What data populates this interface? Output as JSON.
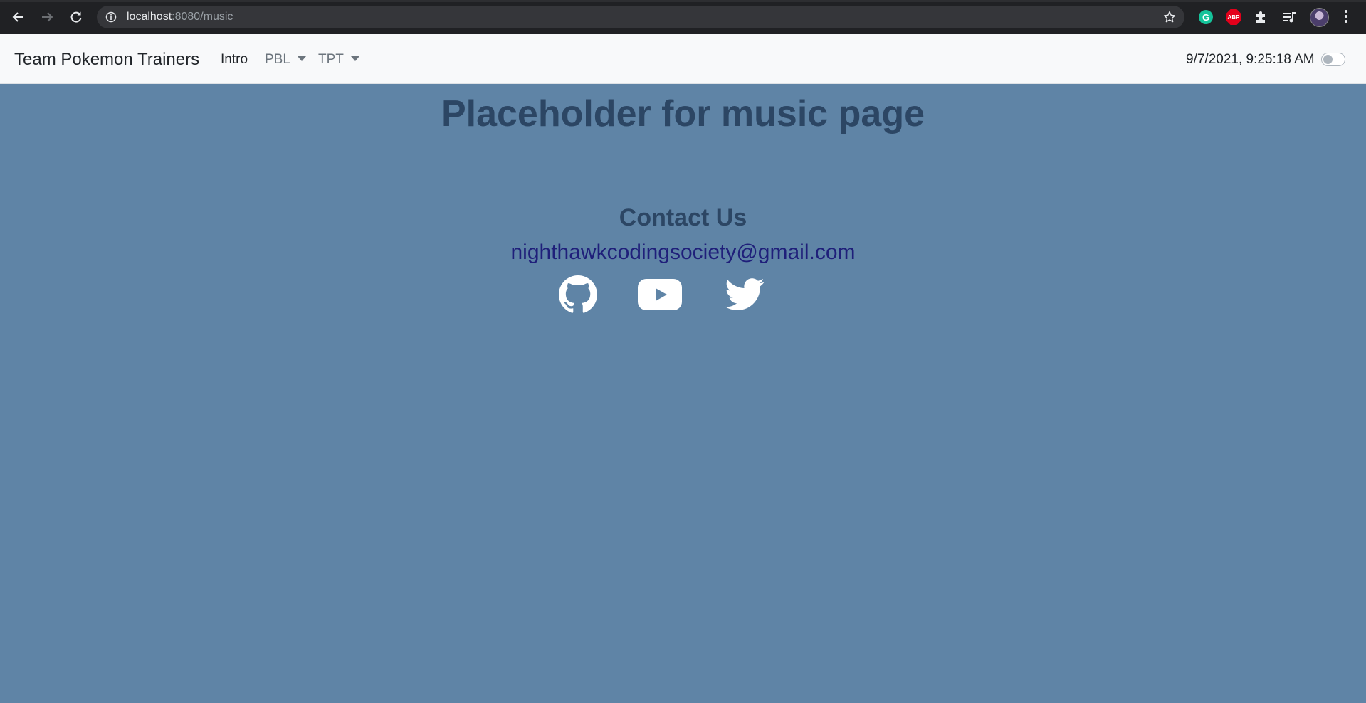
{
  "browser": {
    "url_host": "localhost",
    "url_path": ":8080/music",
    "extensions": {
      "grammarly_label": "G",
      "adblock_label": "ABP"
    }
  },
  "navbar": {
    "brand": "Team Pokemon Trainers",
    "links": [
      {
        "label": "Intro",
        "dropdown": false
      },
      {
        "label": "PBL",
        "dropdown": true
      },
      {
        "label": "TPT",
        "dropdown": true
      }
    ],
    "datetime": "9/7/2021, 9:25:18 AM",
    "dark_mode_toggle": false
  },
  "main": {
    "heading": "Placeholder for music page"
  },
  "contact": {
    "heading": "Contact Us",
    "email": "nighthawkcodingsociety@gmail.com",
    "social_icons": [
      "github-icon",
      "youtube-icon",
      "twitter-icon"
    ]
  },
  "colors": {
    "page_background": "#5f84a6",
    "heading_text": "#2c4664",
    "email_link": "#1f1f7a",
    "navbar_background": "#f8f9fa",
    "chrome_background": "#202124"
  }
}
